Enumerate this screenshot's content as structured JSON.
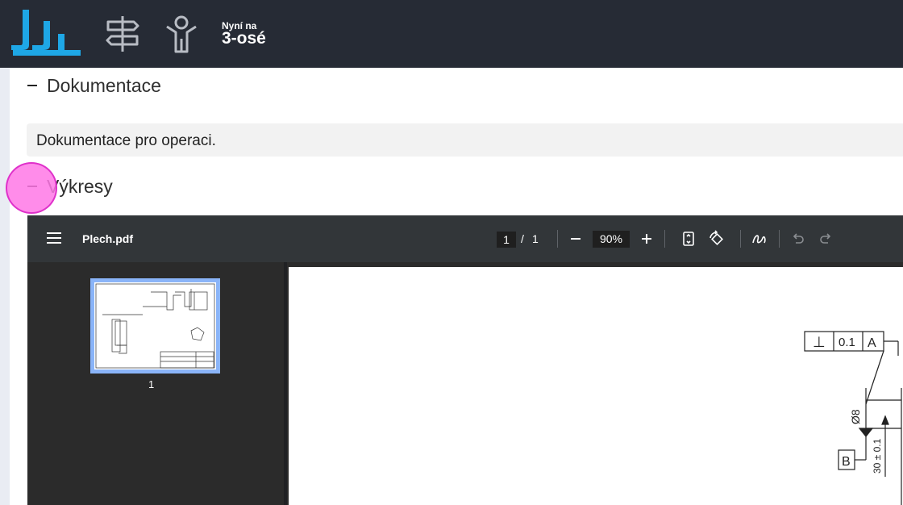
{
  "header": {
    "now_label": "Nyní na",
    "now_value": "3-osé",
    "icons": [
      "logo-icon",
      "signpost-icon",
      "operator-icon"
    ]
  },
  "sections": [
    {
      "title": "Dokumentace",
      "description": "Dokumentace pro operaci."
    },
    {
      "title": "Výkresy"
    }
  ],
  "pdf_viewer": {
    "file_name": "Plech.pdf",
    "current_page": "1",
    "separator": "/",
    "total_pages": "1",
    "zoom": "90%",
    "thumbnail_label": "1",
    "drawing_labels": {
      "perpendicularity_symbol": "⊥",
      "tolerance": "0.1",
      "datum_a": "A",
      "datum_b": "B",
      "diameter": "Ø8",
      "dimension": "30 ± 0.1"
    }
  },
  "colors": {
    "header_bg": "#262b35",
    "accent": "#1ea7e6",
    "viewer_bg": "#2b2b2b",
    "thumb_highlight": "#8ab4f8"
  }
}
